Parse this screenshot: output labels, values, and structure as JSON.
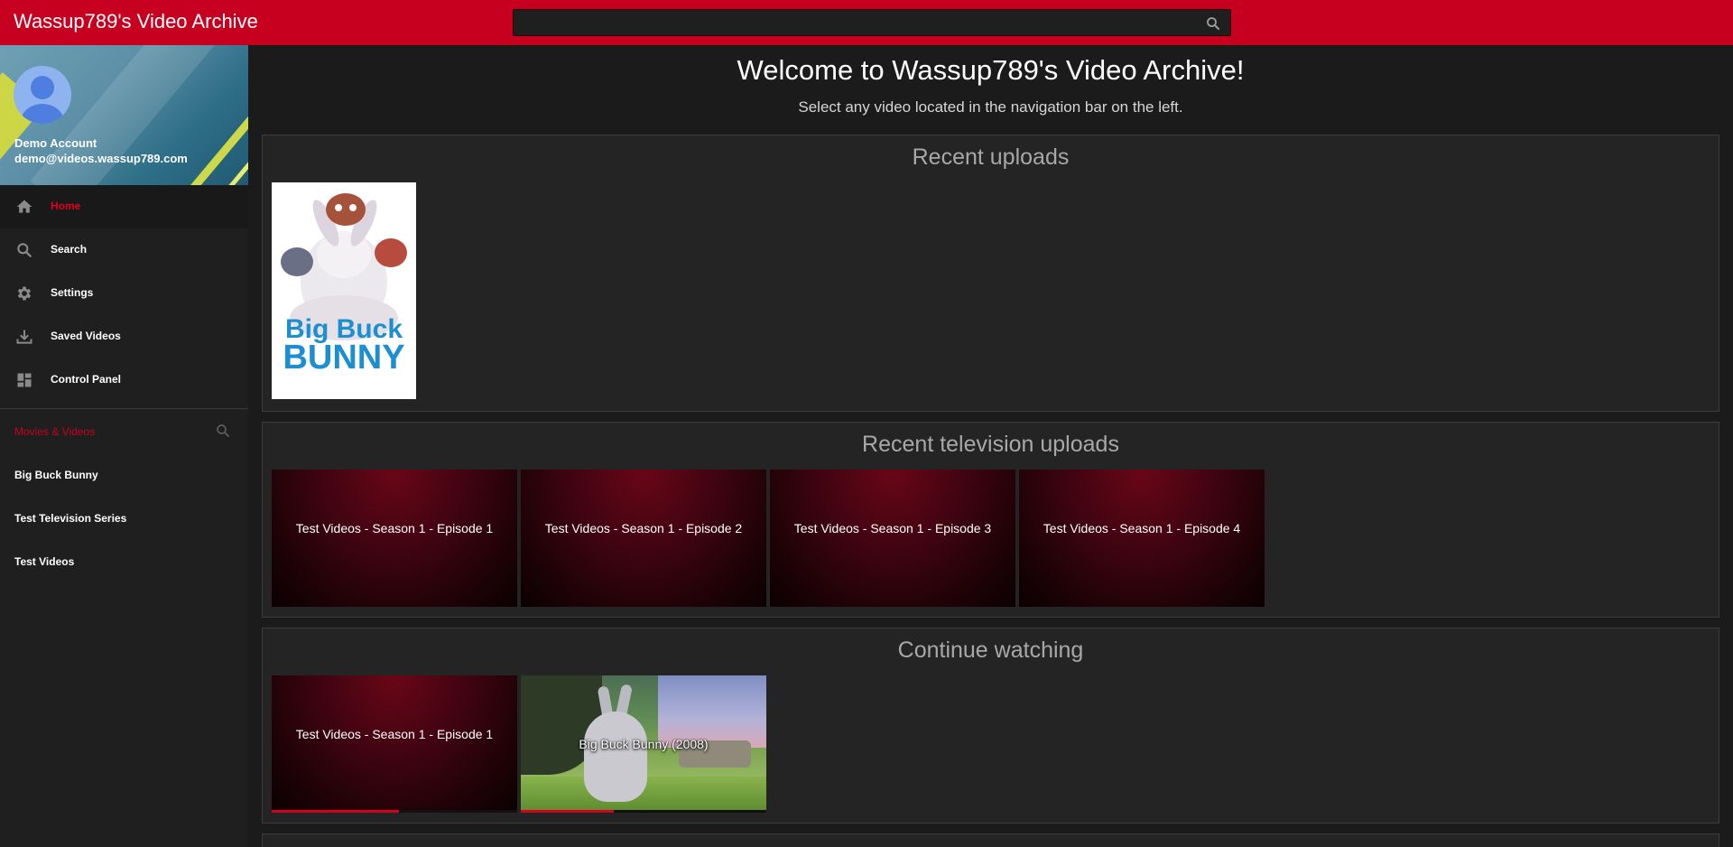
{
  "header": {
    "app_title": "Wassup789's Video Archive",
    "search_placeholder": "",
    "search_icon": "search-icon"
  },
  "account": {
    "name": "Demo Account",
    "email": "demo@videos.wassup789.com"
  },
  "nav": [
    {
      "label": "Home",
      "icon": "home-icon",
      "active": true
    },
    {
      "label": "Search",
      "icon": "search-icon"
    },
    {
      "label": "Settings",
      "icon": "gear-icon"
    },
    {
      "label": "Saved Videos",
      "icon": "download-icon"
    },
    {
      "label": "Control Panel",
      "icon": "dashboard-icon"
    }
  ],
  "library": {
    "section_title": "Movies & Videos",
    "items": [
      "Big Buck Bunny",
      "Test Television Series",
      "Test Videos"
    ]
  },
  "main": {
    "welcome": "Welcome to Wassup789's Video Archive!",
    "subtitle": "Select any video located in the navigation bar on the left.",
    "recent_uploads": {
      "title": "Recent uploads",
      "posters": [
        {
          "title_text_1": "Big Buck",
          "title_text_2": "BUNNY"
        }
      ]
    },
    "recent_tv": {
      "title": "Recent television uploads",
      "tiles": [
        "Test Videos - Season 1 - Episode 1",
        "Test Videos - Season 1 - Episode 2",
        "Test Videos - Season 1 - Episode 3",
        "Test Videos - Season 1 - Episode 4"
      ]
    },
    "continue_watching": {
      "title": "Continue watching",
      "tiles": [
        {
          "label": "Test Videos - Season 1 - Episode 1",
          "progress": 0.52
        },
        {
          "label": "Big Buck Bunny (2008)",
          "progress": 0.38
        }
      ]
    }
  },
  "colors": {
    "accent": "#c8001f",
    "background": "#1b1b1b",
    "panel": "#242424"
  }
}
